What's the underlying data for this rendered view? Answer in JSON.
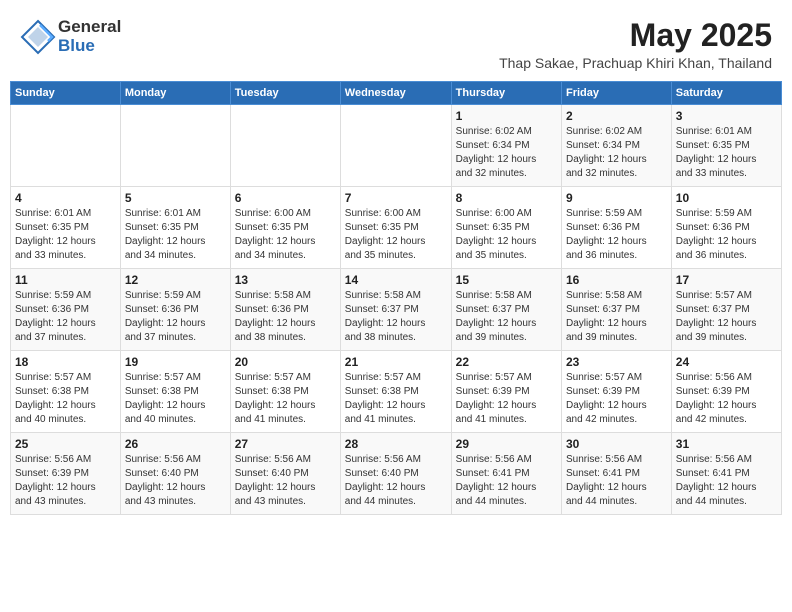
{
  "header": {
    "logo_general": "General",
    "logo_blue": "Blue",
    "month_title": "May 2025",
    "location": "Thap Sakae, Prachuap Khiri Khan, Thailand"
  },
  "weekdays": [
    "Sunday",
    "Monday",
    "Tuesday",
    "Wednesday",
    "Thursday",
    "Friday",
    "Saturday"
  ],
  "weeks": [
    [
      {
        "day": "",
        "info": ""
      },
      {
        "day": "",
        "info": ""
      },
      {
        "day": "",
        "info": ""
      },
      {
        "day": "",
        "info": ""
      },
      {
        "day": "1",
        "info": "Sunrise: 6:02 AM\nSunset: 6:34 PM\nDaylight: 12 hours\nand 32 minutes."
      },
      {
        "day": "2",
        "info": "Sunrise: 6:02 AM\nSunset: 6:34 PM\nDaylight: 12 hours\nand 32 minutes."
      },
      {
        "day": "3",
        "info": "Sunrise: 6:01 AM\nSunset: 6:35 PM\nDaylight: 12 hours\nand 33 minutes."
      }
    ],
    [
      {
        "day": "4",
        "info": "Sunrise: 6:01 AM\nSunset: 6:35 PM\nDaylight: 12 hours\nand 33 minutes."
      },
      {
        "day": "5",
        "info": "Sunrise: 6:01 AM\nSunset: 6:35 PM\nDaylight: 12 hours\nand 34 minutes."
      },
      {
        "day": "6",
        "info": "Sunrise: 6:00 AM\nSunset: 6:35 PM\nDaylight: 12 hours\nand 34 minutes."
      },
      {
        "day": "7",
        "info": "Sunrise: 6:00 AM\nSunset: 6:35 PM\nDaylight: 12 hours\nand 35 minutes."
      },
      {
        "day": "8",
        "info": "Sunrise: 6:00 AM\nSunset: 6:35 PM\nDaylight: 12 hours\nand 35 minutes."
      },
      {
        "day": "9",
        "info": "Sunrise: 5:59 AM\nSunset: 6:36 PM\nDaylight: 12 hours\nand 36 minutes."
      },
      {
        "day": "10",
        "info": "Sunrise: 5:59 AM\nSunset: 6:36 PM\nDaylight: 12 hours\nand 36 minutes."
      }
    ],
    [
      {
        "day": "11",
        "info": "Sunrise: 5:59 AM\nSunset: 6:36 PM\nDaylight: 12 hours\nand 37 minutes."
      },
      {
        "day": "12",
        "info": "Sunrise: 5:59 AM\nSunset: 6:36 PM\nDaylight: 12 hours\nand 37 minutes."
      },
      {
        "day": "13",
        "info": "Sunrise: 5:58 AM\nSunset: 6:36 PM\nDaylight: 12 hours\nand 38 minutes."
      },
      {
        "day": "14",
        "info": "Sunrise: 5:58 AM\nSunset: 6:37 PM\nDaylight: 12 hours\nand 38 minutes."
      },
      {
        "day": "15",
        "info": "Sunrise: 5:58 AM\nSunset: 6:37 PM\nDaylight: 12 hours\nand 39 minutes."
      },
      {
        "day": "16",
        "info": "Sunrise: 5:58 AM\nSunset: 6:37 PM\nDaylight: 12 hours\nand 39 minutes."
      },
      {
        "day": "17",
        "info": "Sunrise: 5:57 AM\nSunset: 6:37 PM\nDaylight: 12 hours\nand 39 minutes."
      }
    ],
    [
      {
        "day": "18",
        "info": "Sunrise: 5:57 AM\nSunset: 6:38 PM\nDaylight: 12 hours\nand 40 minutes."
      },
      {
        "day": "19",
        "info": "Sunrise: 5:57 AM\nSunset: 6:38 PM\nDaylight: 12 hours\nand 40 minutes."
      },
      {
        "day": "20",
        "info": "Sunrise: 5:57 AM\nSunset: 6:38 PM\nDaylight: 12 hours\nand 41 minutes."
      },
      {
        "day": "21",
        "info": "Sunrise: 5:57 AM\nSunset: 6:38 PM\nDaylight: 12 hours\nand 41 minutes."
      },
      {
        "day": "22",
        "info": "Sunrise: 5:57 AM\nSunset: 6:39 PM\nDaylight: 12 hours\nand 41 minutes."
      },
      {
        "day": "23",
        "info": "Sunrise: 5:57 AM\nSunset: 6:39 PM\nDaylight: 12 hours\nand 42 minutes."
      },
      {
        "day": "24",
        "info": "Sunrise: 5:56 AM\nSunset: 6:39 PM\nDaylight: 12 hours\nand 42 minutes."
      }
    ],
    [
      {
        "day": "25",
        "info": "Sunrise: 5:56 AM\nSunset: 6:39 PM\nDaylight: 12 hours\nand 43 minutes."
      },
      {
        "day": "26",
        "info": "Sunrise: 5:56 AM\nSunset: 6:40 PM\nDaylight: 12 hours\nand 43 minutes."
      },
      {
        "day": "27",
        "info": "Sunrise: 5:56 AM\nSunset: 6:40 PM\nDaylight: 12 hours\nand 43 minutes."
      },
      {
        "day": "28",
        "info": "Sunrise: 5:56 AM\nSunset: 6:40 PM\nDaylight: 12 hours\nand 44 minutes."
      },
      {
        "day": "29",
        "info": "Sunrise: 5:56 AM\nSunset: 6:41 PM\nDaylight: 12 hours\nand 44 minutes."
      },
      {
        "day": "30",
        "info": "Sunrise: 5:56 AM\nSunset: 6:41 PM\nDaylight: 12 hours\nand 44 minutes."
      },
      {
        "day": "31",
        "info": "Sunrise: 5:56 AM\nSunset: 6:41 PM\nDaylight: 12 hours\nand 44 minutes."
      }
    ]
  ]
}
